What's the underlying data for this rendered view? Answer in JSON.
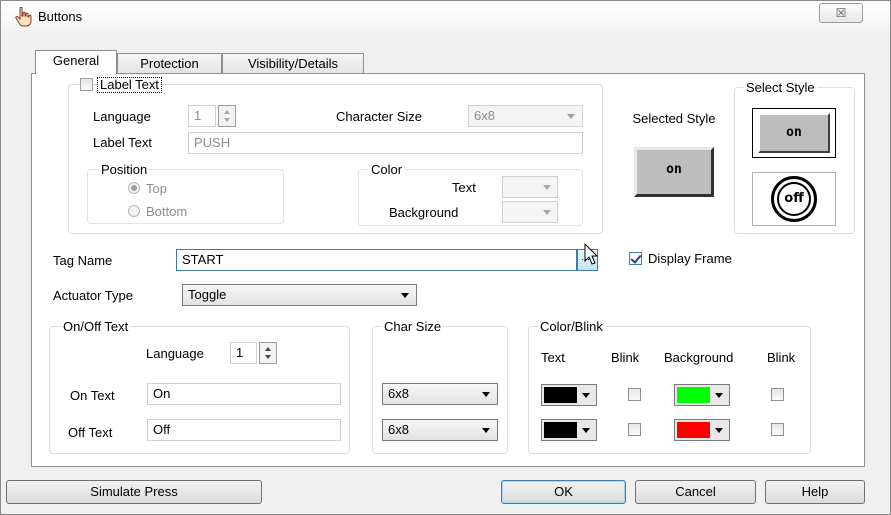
{
  "window": {
    "title": "Buttons",
    "close_label": "☒"
  },
  "tabs": [
    "General",
    "Protection",
    "Visibility/Details"
  ],
  "label_text_group": {
    "checkbox_label": "Label Text",
    "language_label": "Language",
    "language_value": "1",
    "char_size_label": "Character Size",
    "char_size_value": "6x8",
    "label_text_label": "Label Text",
    "label_text_value": "PUSH",
    "position": {
      "title": "Position",
      "top": "Top",
      "bottom": "Bottom"
    },
    "color": {
      "title": "Color",
      "text_label": "Text",
      "background_label": "Background"
    }
  },
  "style_preview": {
    "selected_style_label": "Selected Style",
    "selected_style_text": "on",
    "select_style_title": "Select Style",
    "option_on_text": "on",
    "option_off_text": "off"
  },
  "tag_name": {
    "label": "Tag Name",
    "value": "START"
  },
  "display_frame": {
    "label": "Display Frame",
    "checked": true
  },
  "actuator_type": {
    "label": "Actuator Type",
    "value": "Toggle"
  },
  "onoff_text": {
    "title": "On/Off Text",
    "language_label": "Language",
    "language_value": "1",
    "on_label": "On Text",
    "on_value": "On",
    "off_label": "Off Text",
    "off_value": "Off"
  },
  "char_size": {
    "title": "Char Size",
    "on_value": "6x8",
    "off_value": "6x8"
  },
  "color_blink": {
    "title": "Color/Blink",
    "headers": [
      "Text",
      "Blink",
      "Background",
      "Blink"
    ],
    "rows": [
      {
        "text_color": "#000000",
        "bg_color": "#00ff00"
      },
      {
        "text_color": "#000000",
        "bg_color": "#ff0000"
      }
    ]
  },
  "buttons": {
    "simulate": "Simulate Press",
    "ok": "OK",
    "cancel": "Cancel",
    "help": "Help"
  }
}
